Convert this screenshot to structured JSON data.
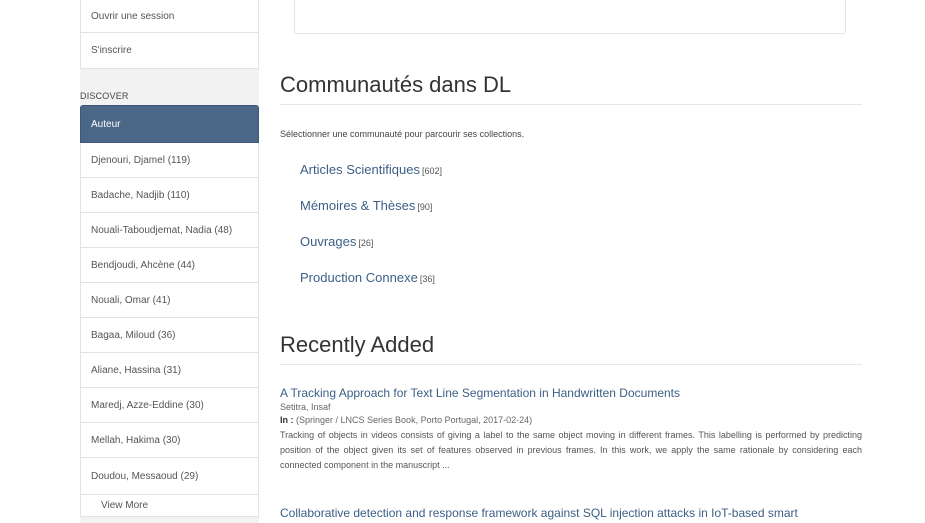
{
  "sidebar": {
    "account_items": [
      {
        "label": "Ouvrir une session"
      },
      {
        "label": "S'inscrire"
      }
    ],
    "discover_title": "DISCOVER",
    "active_facet": "Auteur",
    "authors": [
      {
        "label": "Djenouri, Djamel (119)"
      },
      {
        "label": "Badache, Nadjib (110)"
      },
      {
        "label": "Nouali-Taboudjemat, Nadia (48)"
      },
      {
        "label": "Bendjoudi, Ahcène (44)"
      },
      {
        "label": "Nouali, Omar (41)"
      },
      {
        "label": "Bagaa, Miloud (36)"
      },
      {
        "label": "Aliane, Hassina (31)"
      },
      {
        "label": "Maredj, Azze-Eddine (30)"
      },
      {
        "label": "Mellah, Hakima (30)"
      },
      {
        "label": "Doudou, Messaoud (29)"
      }
    ],
    "view_more": "View More"
  },
  "main": {
    "communities_title": "Communautés dans DL",
    "communities_intro": "Sélectionner une communauté pour parcourir ses collections.",
    "communities": [
      {
        "name": "Articles Scientifiques",
        "count": "[602]"
      },
      {
        "name": "Mémoires & Thèses",
        "count": "[90]"
      },
      {
        "name": "Ouvrages",
        "count": "[26]"
      },
      {
        "name": "Production Connexe",
        "count": "[36]"
      }
    ],
    "recent_title": "Recently Added",
    "recent_items": [
      {
        "title": "A Tracking Approach for Text Line Segmentation in Handwritten Documents",
        "author": "Setitra, Insaf",
        "pub_prefix": "In :",
        "pub": "(Springer / LNCS Series Book, Porto Portugal, 2017-02-24)",
        "abstract": "Tracking of objects in videos consists of giving a label to the same object moving in different frames. This labelling is performed by predicting position of the object given its set of features observed in previous frames. In this work, we apply the same rationale by considering each connected component in the manuscript ..."
      },
      {
        "title": "Collaborative detection and response framework against SQL injection attacks in IoT-based smart"
      }
    ]
  }
}
